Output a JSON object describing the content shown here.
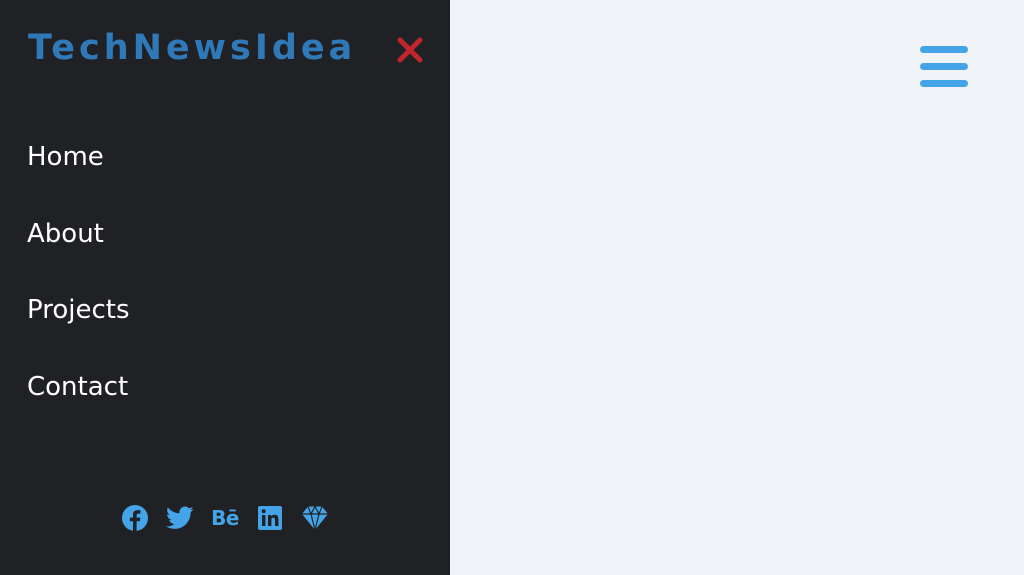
{
  "brand": {
    "title": "TechNewsIdea"
  },
  "nav": {
    "items": [
      {
        "label": "Home"
      },
      {
        "label": "About"
      },
      {
        "label": "Projects"
      },
      {
        "label": "Contact"
      }
    ]
  },
  "social": {
    "icons": [
      "facebook-icon",
      "twitter-icon",
      "behance-icon",
      "linkedin-icon",
      "sketch-icon"
    ],
    "behance_text": "Bē"
  },
  "colors": {
    "sidebar_bg": "#202124",
    "page_bg": "#f0f3f7",
    "brand": "#2f79b8",
    "accent": "#45a4e8",
    "close": "#c0262c"
  }
}
